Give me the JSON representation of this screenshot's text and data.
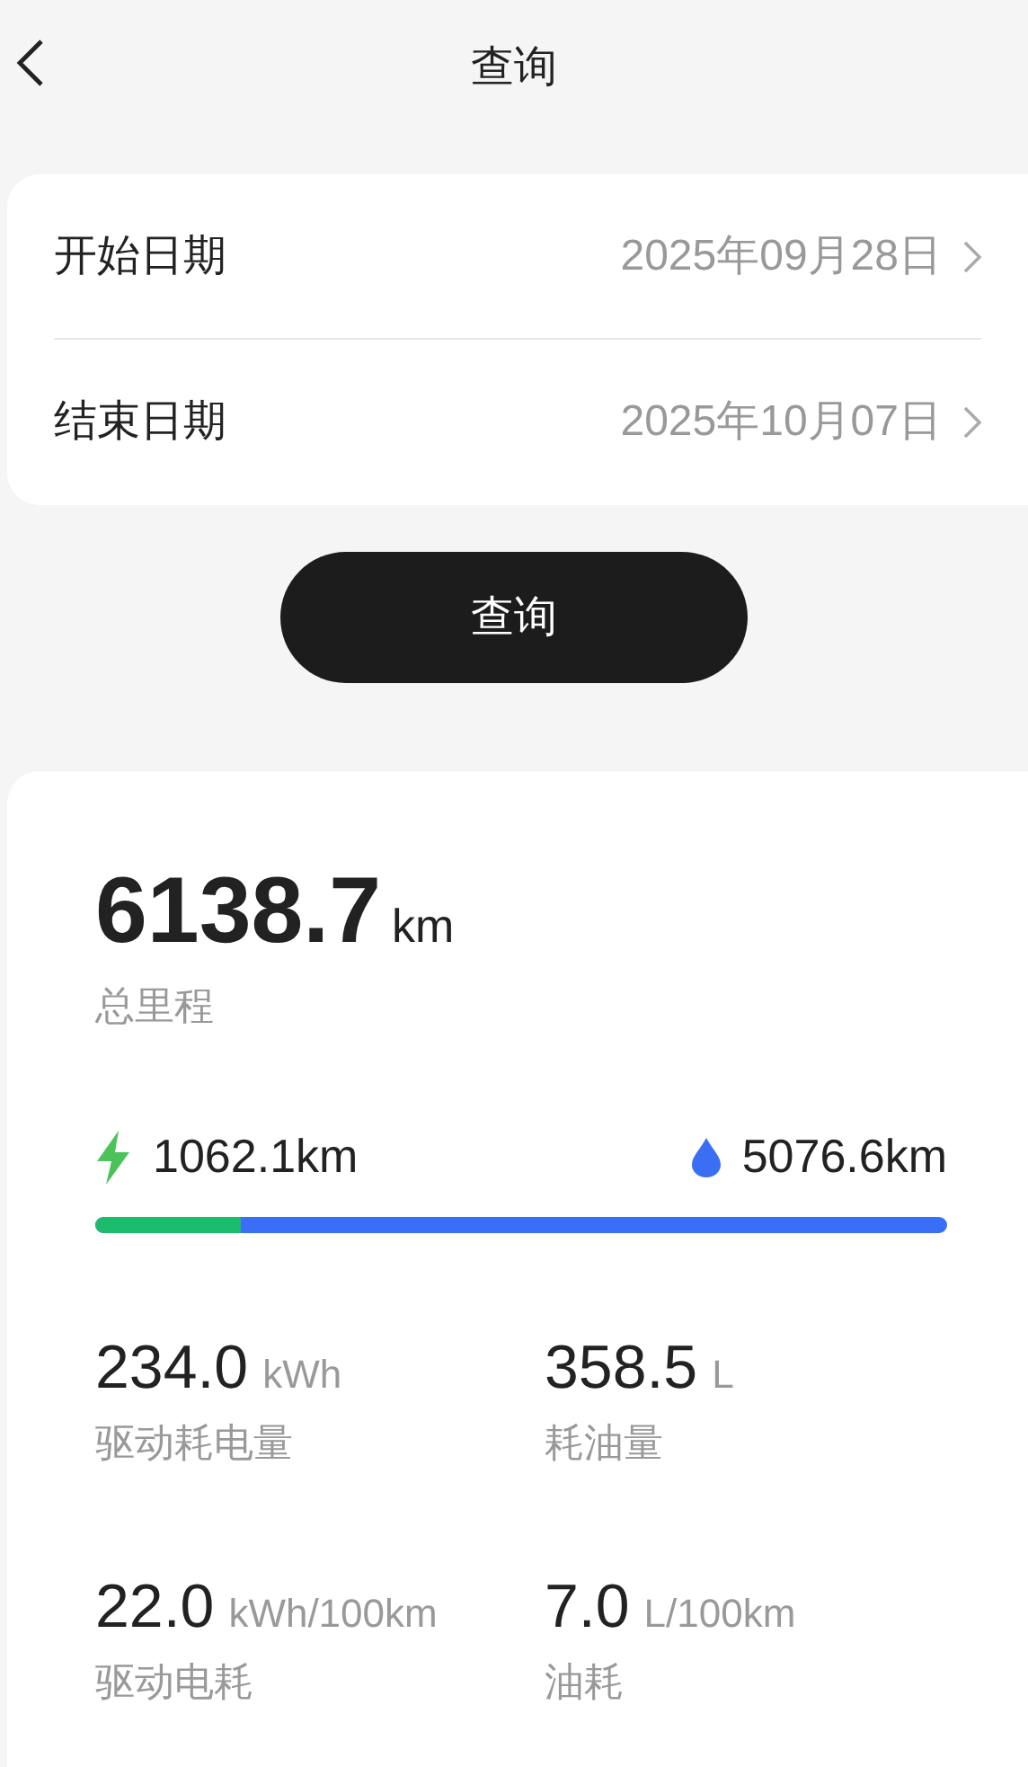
{
  "header": {
    "title": "查询"
  },
  "date_rows": [
    {
      "label": "开始日期",
      "value": "2025年09月28日"
    },
    {
      "label": "结束日期",
      "value": "2025年10月07日"
    }
  ],
  "query_button": {
    "label": "查询"
  },
  "summary": {
    "total": {
      "value": "6138.7",
      "unit": "km",
      "label": "总里程"
    },
    "electric": {
      "value": "1062.1",
      "unit": "km"
    },
    "fuel": {
      "value": "5076.6",
      "unit": "km"
    },
    "split_bar": {
      "level": 0.17
    },
    "stats": [
      {
        "value": "234.0",
        "unit": "kWh",
        "label": "驱动耗电量"
      },
      {
        "value": "358.5",
        "unit": "L",
        "label": "耗油量"
      },
      {
        "value": "22.0",
        "unit": "kWh/100km",
        "label": "驱动电耗"
      },
      {
        "value": "7.0",
        "unit": "L/100km",
        "label": "油耗"
      }
    ]
  }
}
